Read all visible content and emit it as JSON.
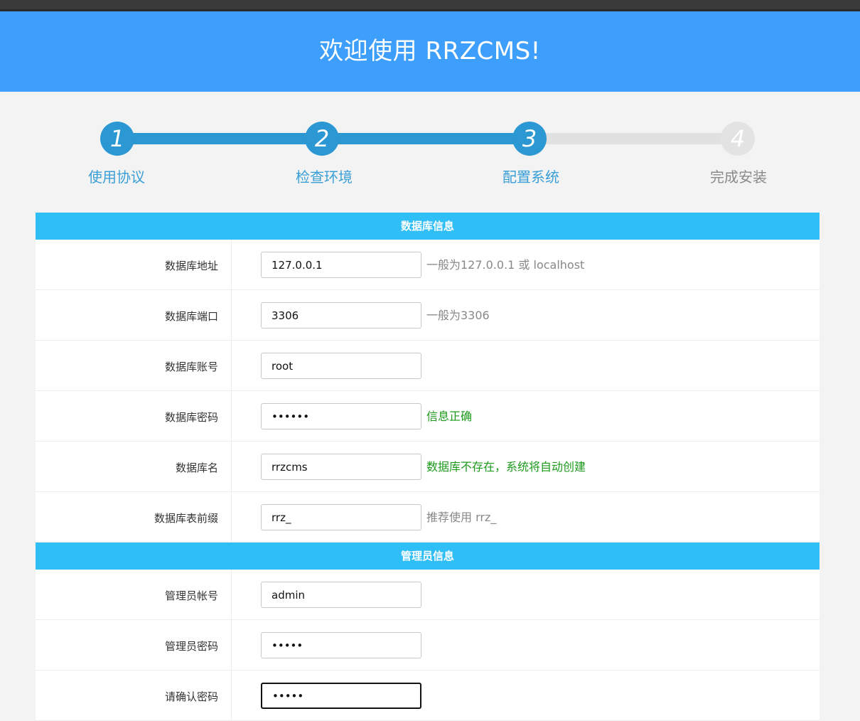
{
  "header": {
    "title": "欢迎使用 RRZCMS!"
  },
  "steps": [
    {
      "num": "1",
      "label": "使用协议"
    },
    {
      "num": "2",
      "label": "检查环境"
    },
    {
      "num": "3",
      "label": "配置系统"
    },
    {
      "num": "4",
      "label": "完成安装"
    }
  ],
  "current_step": 3,
  "db": {
    "title": "数据库信息",
    "rows": [
      {
        "label": "数据库地址",
        "value": "127.0.0.1",
        "hint": "一般为127.0.0.1 或 localhost"
      },
      {
        "label": "数据库端口",
        "value": "3306",
        "hint": "一般为3306"
      },
      {
        "label": "数据库账号",
        "value": "root",
        "hint": ""
      },
      {
        "label": "数据库密码",
        "value": "••••••",
        "hint": "信息正确"
      },
      {
        "label": "数据库名",
        "value": "rrzcms",
        "hint": "数据库不存在，系统将自动创建"
      },
      {
        "label": "数据库表前缀",
        "value": "rrz_",
        "hint": "推荐使用 rrz_"
      }
    ]
  },
  "admin": {
    "title": "管理员信息",
    "rows": [
      {
        "label": "管理员帐号",
        "value": "admin"
      },
      {
        "label": "管理员密码",
        "value": "•••••"
      },
      {
        "label": "请确认密码",
        "value": "•••••"
      }
    ]
  },
  "colors": {
    "header": "#3d9ffb",
    "section": "#30bef6",
    "step_active": "#2b97d3",
    "ok_text": "#1b9a1b"
  }
}
